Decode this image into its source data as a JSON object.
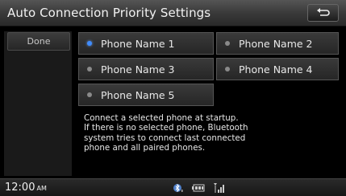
{
  "header": {
    "title": "Auto Connection Priority Settings",
    "back_icon": "back-arrow-icon"
  },
  "sidebar": {
    "done_label": "Done"
  },
  "phones": [
    {
      "label": "Phone Name 1",
      "selected": true
    },
    {
      "label": "Phone Name 2",
      "selected": false
    },
    {
      "label": "Phone Name 3",
      "selected": false
    },
    {
      "label": "Phone Name 4",
      "selected": false
    },
    {
      "label": "Phone Name 5",
      "selected": false
    }
  ],
  "help_lines": [
    "Connect a selected phone at startup.",
    "If there is no selected phone, Bluetooth",
    "system tries to connect last connected",
    "phone and all paired phones."
  ],
  "status_bar": {
    "time": "12:00",
    "ampm": "AM",
    "icons": [
      "bluetooth-icon",
      "battery-icon",
      "signal-icon"
    ]
  },
  "colors": {
    "selected_dot": "#3f8cff",
    "unselected_dot": "#8a8a8a",
    "title_text": "#f2f2f2"
  }
}
